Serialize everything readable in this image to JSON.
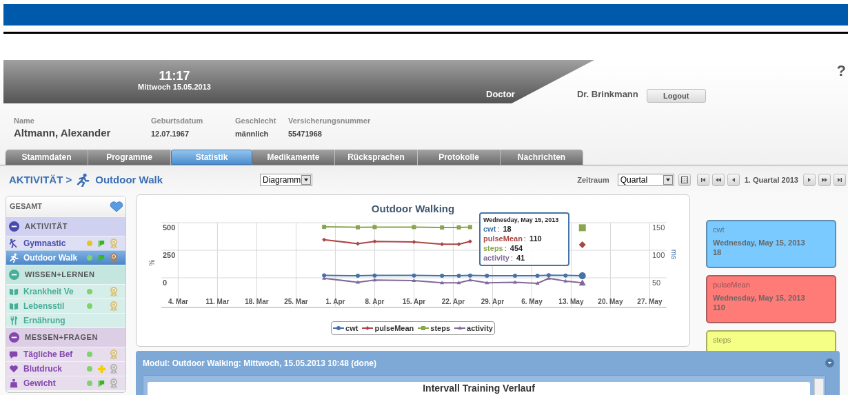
{
  "header": {
    "time": "11:17",
    "date": "Mittwoch 15.05.2013",
    "role": "Doctor",
    "user": "Dr. Brinkmann",
    "logout_button": "Logout",
    "help": "?"
  },
  "patient": {
    "fields": [
      {
        "label": "Name",
        "value": "Altmann, Alexander",
        "kind": "primary"
      },
      {
        "label": "Geburtsdatum",
        "value": "12.07.1967",
        "kind": "normal"
      },
      {
        "label": "Geschlecht",
        "value": "männlich",
        "kind": "normal"
      },
      {
        "label": "Versicherungsnummer",
        "value": "55471968",
        "kind": "normal"
      }
    ]
  },
  "tabs": [
    {
      "label": "Stammdaten",
      "selected": false
    },
    {
      "label": "Programme",
      "selected": false
    },
    {
      "label": "Statistik",
      "selected": true
    },
    {
      "label": "Medikamente",
      "selected": false
    },
    {
      "label": "Rücksprachen",
      "selected": false
    },
    {
      "label": "Protokolle",
      "selected": false
    },
    {
      "label": "Nachrichten",
      "selected": false
    }
  ],
  "toolbar": {
    "breadcrumb": "AKTIVITÄT >",
    "module": "Outdoor Walk",
    "view_select": "Diagramm",
    "period_label": "Zeitraum",
    "period_select": "Quartal",
    "period": "1. Quartal 2013"
  },
  "sidebar": {
    "title": "GESAMT",
    "groups": [
      {
        "label": "AKTIVITÄT",
        "color": "#d0d1f0",
        "expanded": true,
        "items": [
          {
            "label": "Gymnastic",
            "kind": "gymnast",
            "selected": false,
            "color": "#e6c619",
            "flag": true,
            "plus": false,
            "medal": {
              "color": "#d5c27a"
            }
          },
          {
            "label": "Outdoor Walk",
            "kind": "runner",
            "selected": true,
            "color": "#7fd36a",
            "flag": true,
            "plus": false,
            "medal": {
              "color": "#a9805e"
            }
          }
        ]
      },
      {
        "label": "WISSEN+LERNEN",
        "color": "#c5e6df",
        "expanded": true,
        "items": [
          {
            "label": "Krankheit Ve",
            "kind": "book",
            "selected": false,
            "color": "#7fd36a",
            "flag": false,
            "plus": false,
            "medal": {
              "color": "#d5c27a"
            }
          },
          {
            "label": "Lebensstil",
            "kind": "book",
            "selected": false,
            "color": "#7fd36a",
            "flag": false,
            "plus": false,
            "medal": {
              "color": "#d5c27a"
            }
          },
          {
            "label": "Ernährung",
            "kind": "cutlery",
            "selected": false,
            "flag": false,
            "plus": false
          }
        ]
      },
      {
        "label": "MESSEN+FRAGEN",
        "color": "#dccfe5",
        "expanded": true,
        "items": [
          {
            "label": "Tägliche Bef",
            "kind": "speech",
            "selected": false,
            "color": "#7fd36a",
            "flag": false,
            "plus": false,
            "medal": {
              "color": "#d5c27a"
            }
          },
          {
            "label": "Blutdruck",
            "kind": "heart",
            "selected": false,
            "color": "#7fd36a",
            "flag": false,
            "plus": true,
            "medal": {
              "color": "#b3b3b3"
            }
          },
          {
            "label": "Gewicht",
            "kind": "weight",
            "selected": false,
            "color": "#7fd36a",
            "flag": true,
            "plus": false,
            "medal": {
              "color": "#b3b3b3"
            }
          }
        ]
      }
    ]
  },
  "chart": {
    "chart_data": {
      "type": "line",
      "title": "Outdoor Walking",
      "ylabel": "%",
      "x": [
        "2013-03-30",
        "2013-04-05",
        "2013-04-08",
        "2013-04-15",
        "2013-04-20",
        "2013-04-23",
        "2013-04-25",
        "2013-04-28",
        "2013-05-03",
        "2013-05-07",
        "2013-05-09",
        "2013-05-12",
        "2013-05-15"
      ],
      "xlim": [
        "2013-03-01",
        "2013-05-30"
      ],
      "grid": true,
      "xticks": [
        {
          "value": "2013-03-04",
          "label": "4. Mar"
        },
        {
          "value": "2013-03-11",
          "label": "11. Mar"
        },
        {
          "value": "2013-03-18",
          "label": "18. Mar"
        },
        {
          "value": "2013-03-25",
          "label": "25. Mar"
        },
        {
          "value": "2013-04-01",
          "label": "1. Apr"
        },
        {
          "value": "2013-04-08",
          "label": "8. Apr"
        },
        {
          "value": "2013-04-15",
          "label": "15. Apr"
        },
        {
          "value": "2013-04-22",
          "label": "22. Apr"
        },
        {
          "value": "2013-04-29",
          "label": "29. Apr"
        },
        {
          "value": "2013-05-06",
          "label": "6. May"
        },
        {
          "value": "2013-05-13",
          "label": "13. May"
        },
        {
          "value": "2013-05-20",
          "label": "20. May"
        },
        {
          "value": "2013-05-27",
          "label": "27. May"
        }
      ],
      "ylim": [
        0,
        500
      ],
      "yticks": [
        0,
        250,
        500
      ],
      "y2label": "ms",
      "y2lim": [
        -3.75,
        150
      ],
      "y2ticks": [
        50,
        100,
        150
      ],
      "legend": true,
      "series": [
        {
          "name": "cwt",
          "color": "#4572a7",
          "marker": "circle",
          "values": [
            22,
            19,
            21,
            21,
            19,
            19,
            21,
            19,
            19,
            19,
            23,
            21,
            18
          ]
        },
        {
          "name": "pulseMean",
          "color": "#aa4643",
          "axis": "y2",
          "marker": "diamond",
          "values": [
            119,
            112,
            116,
            115,
            111,
            111,
            116,
            null,
            null,
            null,
            null,
            null,
            110
          ]
        },
        {
          "name": "steps",
          "color": "#89a54e",
          "marker": "square",
          "values": [
            462,
            458,
            460,
            460,
            456,
            457,
            460,
            null,
            null,
            null,
            null,
            null,
            454
          ]
        },
        {
          "name": "activity",
          "color": "#80699b",
          "axis": "y2",
          "marker": "triangle",
          "values": [
            49,
            42,
            46,
            45,
            41,
            41,
            46,
            41,
            42,
            40,
            49,
            44,
            41
          ]
        }
      ]
    },
    "tooltip": {
      "title": "Wednesday, May 15, 2013",
      "separator": ":",
      "rows": [
        {
          "label": "cwt",
          "value": "18"
        },
        {
          "label": "pulseMean",
          "value": "110"
        },
        {
          "label": "steps",
          "value": "454"
        },
        {
          "label": "activity",
          "value": "41"
        }
      ]
    }
  },
  "cards": [
    {
      "title": "cwt",
      "date": "Wednesday, May 15, 2013",
      "value": "18",
      "color": "#7ac9ff"
    },
    {
      "title": "pulseMean",
      "date": "Wednesday, May 15, 2013",
      "value": "110",
      "color": "#ff7b78"
    },
    {
      "title": "steps",
      "color": "#f5ff86"
    }
  ],
  "module": {
    "title": "Modul: Outdoor Walking: Mittwoch, 15.05.2013 10:48 (done)",
    "content_title": "Intervall Training Verlauf"
  }
}
